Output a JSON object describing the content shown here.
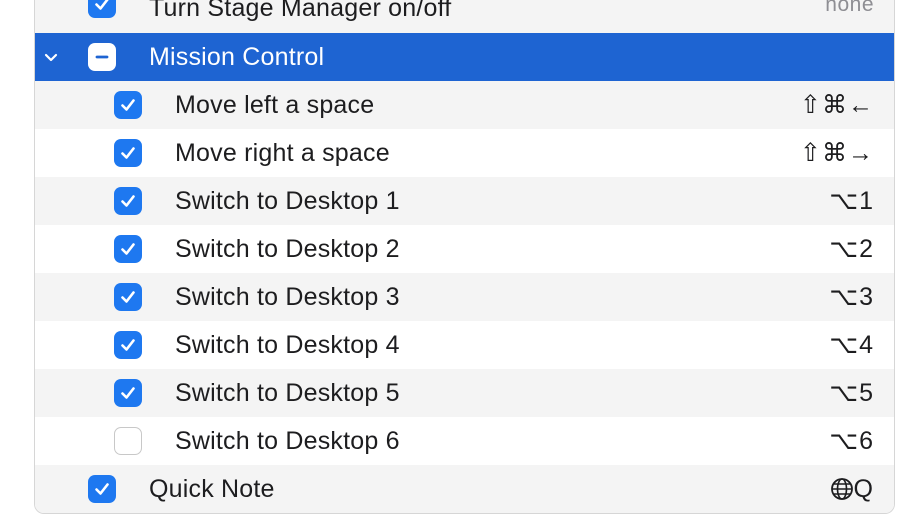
{
  "list": {
    "rows": [
      {
        "label": "Turn Stage Manager on/off",
        "shortcut": "none",
        "checked": true
      },
      {
        "label": "Mission Control",
        "state": "mixed",
        "expanded": true,
        "selected": true
      },
      {
        "label": "Move left a space",
        "shortcut": "⇧⌘←",
        "checked": true
      },
      {
        "label": "Move right a space",
        "shortcut": "⇧⌘→",
        "checked": true
      },
      {
        "label": "Switch to Desktop 1",
        "shortcut": "⌥1",
        "checked": true
      },
      {
        "label": "Switch to Desktop 2",
        "shortcut": "⌥2",
        "checked": true
      },
      {
        "label": "Switch to Desktop 3",
        "shortcut": "⌥3",
        "checked": true
      },
      {
        "label": "Switch to Desktop 4",
        "shortcut": "⌥4",
        "checked": true
      },
      {
        "label": "Switch to Desktop 5",
        "shortcut": "⌥5",
        "checked": true
      },
      {
        "label": "Switch to Desktop 6",
        "shortcut": "⌥6",
        "checked": false
      },
      {
        "label": "Quick Note",
        "shortcut_icon": "globe-icon",
        "shortcut": "Q",
        "checked": true
      }
    ]
  },
  "colors": {
    "accent": "#1e78f0",
    "selection": "#1e64d2",
    "stripe": "#f4f4f4"
  }
}
